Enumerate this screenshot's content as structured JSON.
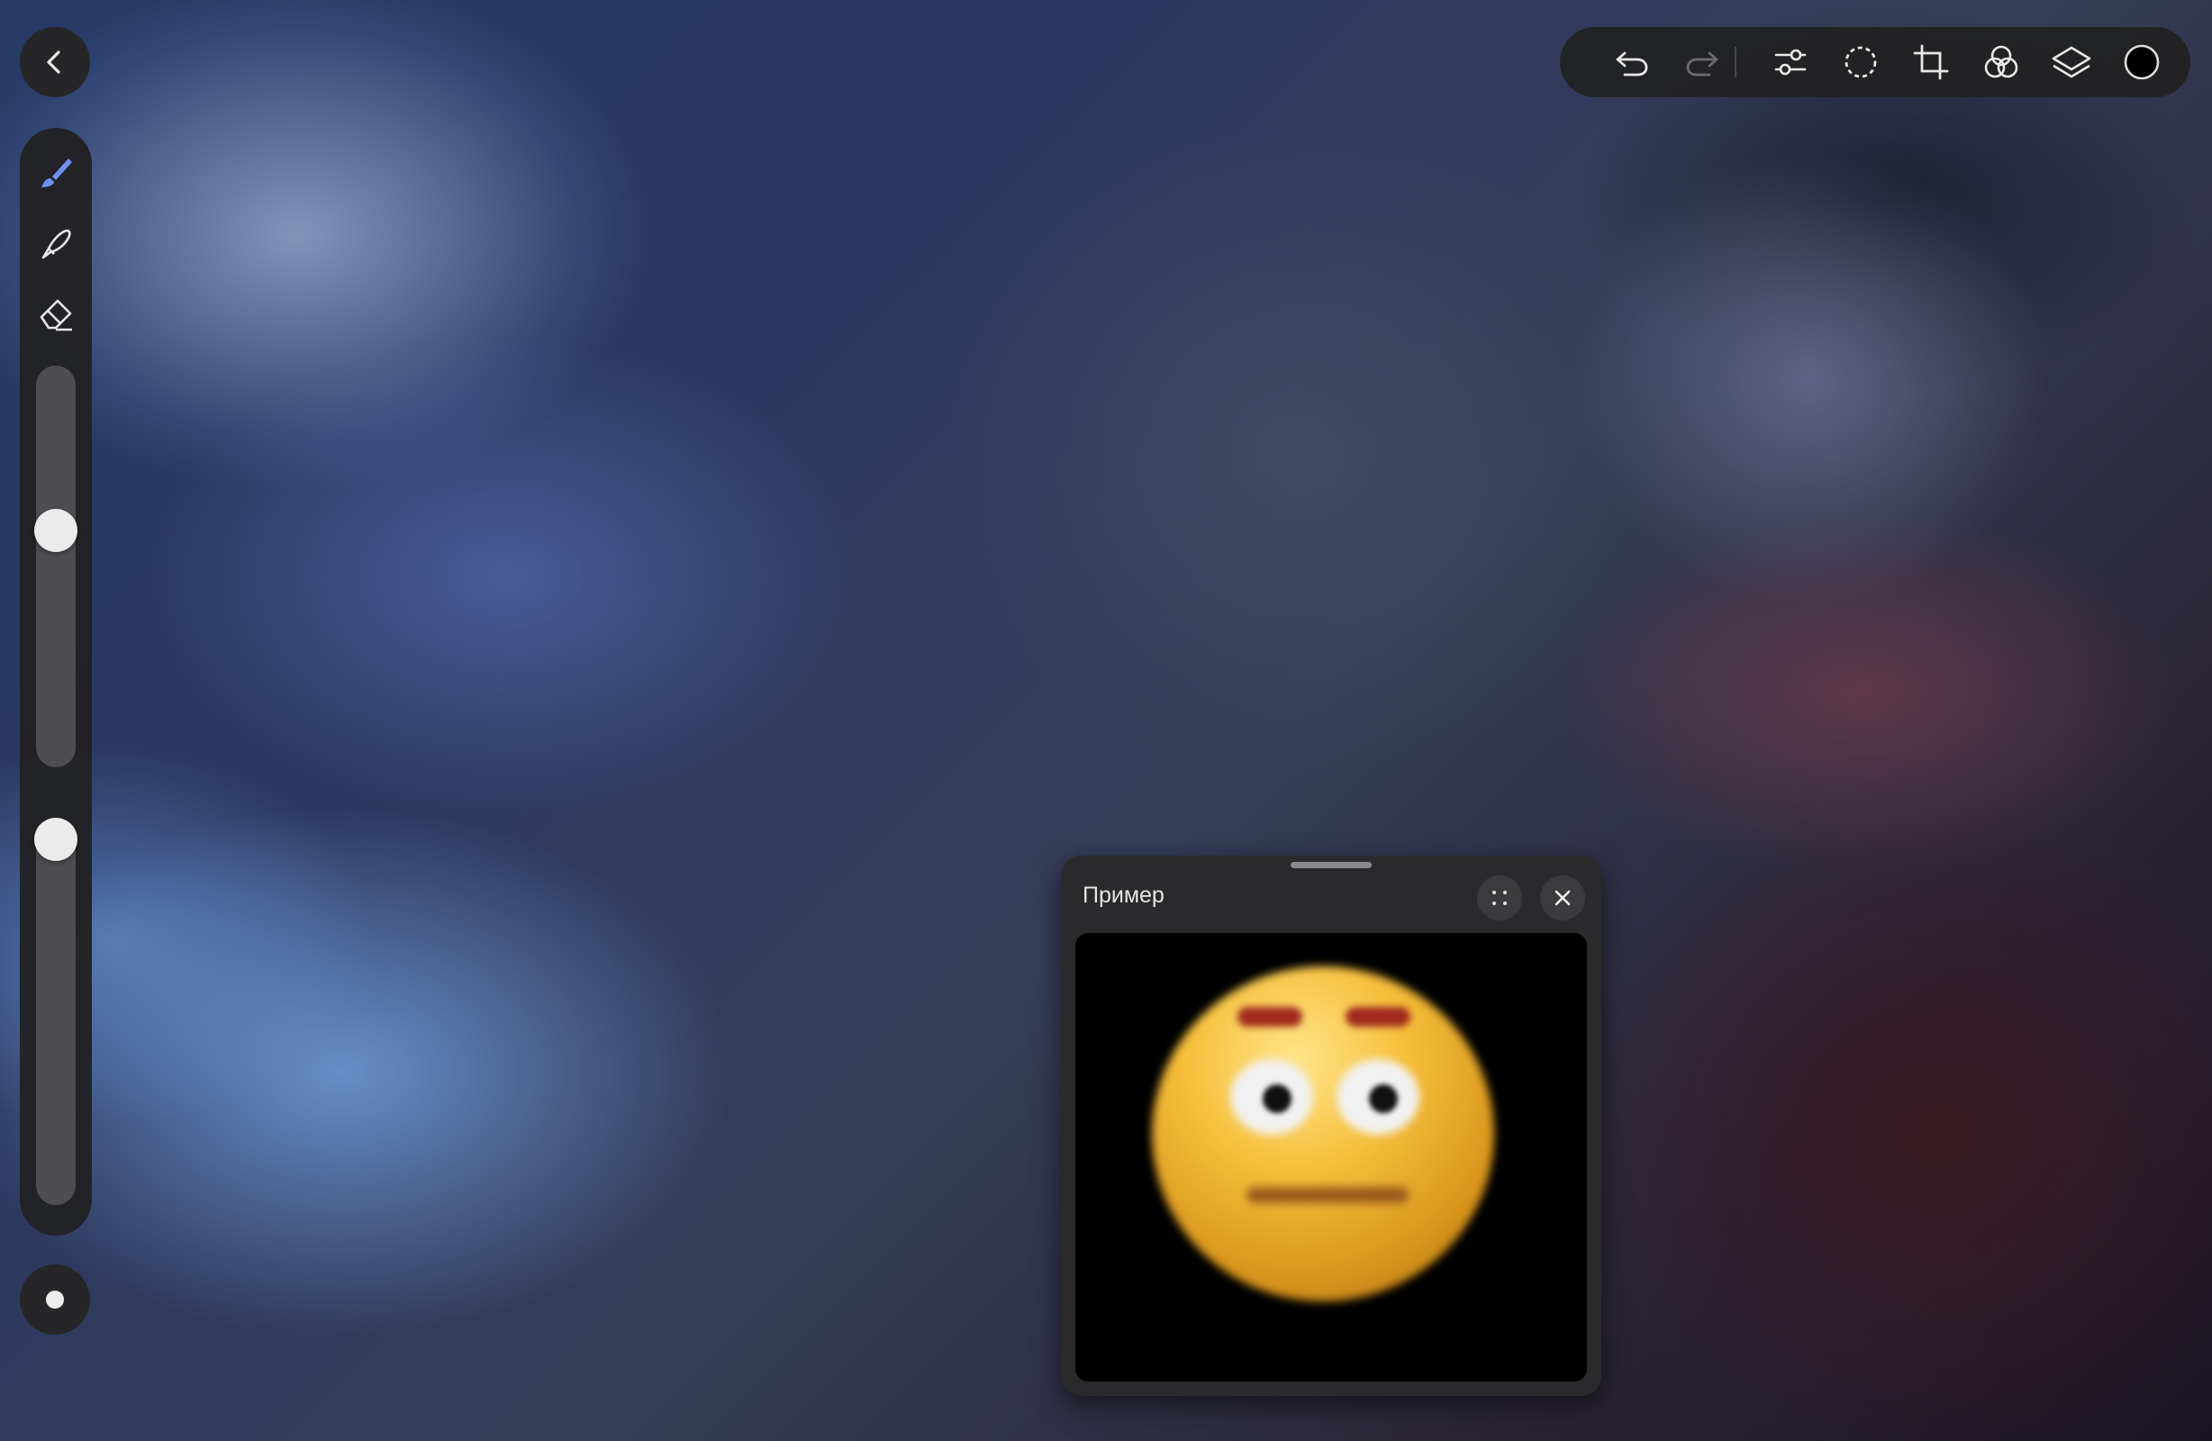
{
  "reference_window": {
    "title": "Пример"
  },
  "sidebar": {
    "size_slider_value": 0.6,
    "opacity_slider_value": 1.0
  },
  "colors": {
    "current_color": "#000000",
    "active_tool": "#6f8ff0"
  },
  "icons": {
    "back": "chevron-left-icon",
    "brush": "brush-icon",
    "smudge": "smudge-icon",
    "eraser": "eraser-icon",
    "undo": "undo-icon",
    "redo": "redo-icon",
    "adjustments": "sliders-icon",
    "selection": "selection-icon",
    "transform": "transform-icon",
    "blend": "blend-circles-icon",
    "layers": "layers-icon",
    "color": "color-swatch-icon"
  }
}
